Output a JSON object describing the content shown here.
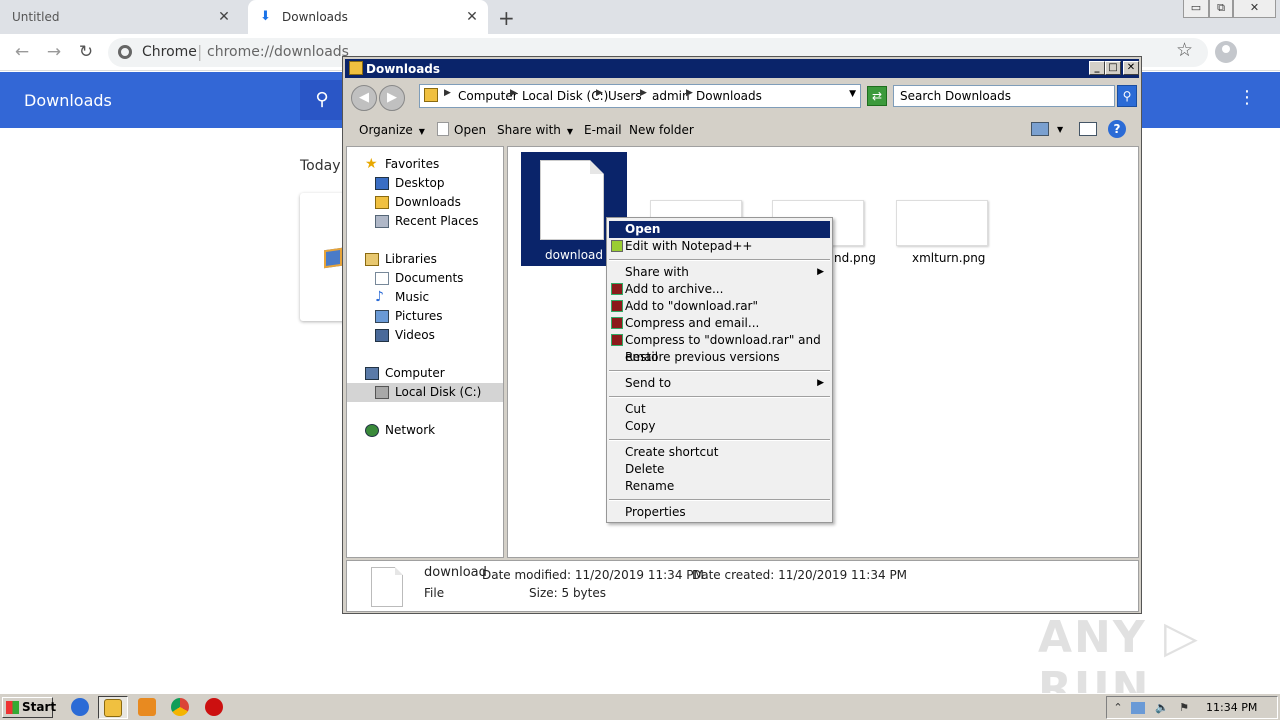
{
  "browser": {
    "tabs": [
      {
        "title": "Untitled",
        "close": "✕"
      },
      {
        "title": "Downloads",
        "close": "✕"
      }
    ],
    "new_tab": "+",
    "window_controls": {
      "minimize": "▭",
      "restore": "⧉",
      "close": "✕"
    },
    "nav": {
      "back": "←",
      "forward": "→",
      "reload": "↻"
    },
    "omnibox": {
      "site": "Chrome",
      "separator": "|",
      "url": "chrome://downloads"
    },
    "star": "☆"
  },
  "downloads_page": {
    "title": "Downloads",
    "search_icon": "⚲",
    "menu_icon": "⋮",
    "section": "Today"
  },
  "explorer": {
    "title": "Downloads",
    "window_buttons": {
      "minimize": "_",
      "maximize": "□",
      "close": "✕"
    },
    "nav": {
      "back": "◀",
      "forward": "▶"
    },
    "breadcrumb": [
      "Computer",
      "Local Disk (C:)",
      "Users",
      "admin",
      "Downloads"
    ],
    "refresh_icon": "⇄",
    "search_placeholder": "Search Downloads",
    "commands": {
      "organize": "Organize",
      "open": "Open",
      "share_with": "Share with",
      "email": "E-mail",
      "new_folder": "New folder"
    },
    "help_icon": "?",
    "nav_pane": {
      "favorites": "Favorites",
      "desktop": "Desktop",
      "downloads": "Downloads",
      "recent_places": "Recent Places",
      "libraries": "Libraries",
      "documents": "Documents",
      "music": "Music",
      "pictures": "Pictures",
      "videos": "Videos",
      "computer": "Computer",
      "local_disk": "Local Disk (C:)",
      "network": "Network"
    },
    "files": [
      {
        "name": "download"
      },
      {
        "name": "nd.png"
      },
      {
        "name": "xmlturn.png"
      }
    ],
    "details": {
      "name": "download",
      "date_modified": "Date modified: 11/20/2019 11:34 PM",
      "date_created": "Date created: 11/20/2019 11:34 PM",
      "type": "File",
      "size": "Size: 5 bytes"
    }
  },
  "context_menu": {
    "open": "Open",
    "edit_npp": "Edit with Notepad++",
    "share_with": "Share with",
    "add_archive": "Add to archive...",
    "add_rar": "Add to \"download.rar\"",
    "compress_email": "Compress and email...",
    "compress_rar_email": "Compress to \"download.rar\" and email",
    "restore": "Restore previous versions",
    "send_to": "Send to",
    "cut": "Cut",
    "copy": "Copy",
    "create_shortcut": "Create shortcut",
    "delete": "Delete",
    "rename": "Rename",
    "properties": "Properties",
    "submenu_arrow": "▶"
  },
  "watermark": "ANY ▷ RUN",
  "taskbar": {
    "start": "Start",
    "tray_expand": "⌃",
    "clock": "11:34 PM"
  }
}
